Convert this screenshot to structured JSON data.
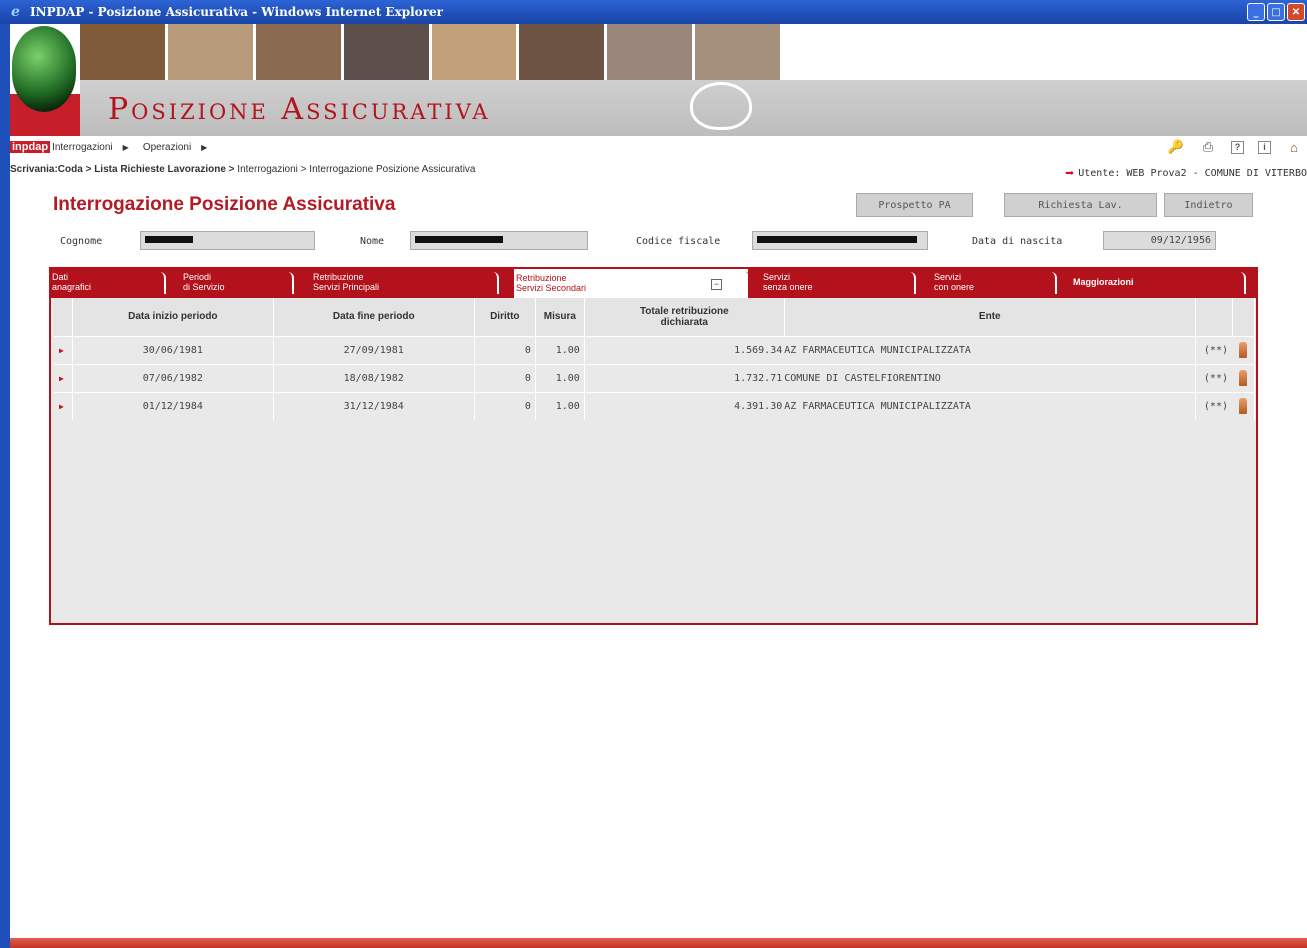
{
  "window": {
    "title": "INPDAP - Posizione Assicurativa - Windows Internet Explorer"
  },
  "header": {
    "title": "Posizione Assicurativa",
    "logo_text": "inpdap",
    "photo_colors": [
      "#7f5b3a",
      "#b69a7a",
      "#8a6b52",
      "#5d4f49",
      "#c2a07c",
      "#6d5344",
      "#99857a",
      "#a58f7d"
    ]
  },
  "menu": {
    "items": [
      {
        "label": "Interrogazioni"
      },
      {
        "label": "Operazioni"
      }
    ]
  },
  "breadcrumb": {
    "bold": "Scrivania:Coda > Lista Richieste Lavorazione >",
    "rest": " Interrogazioni > Interrogazione Posizione Assicurativa"
  },
  "user": {
    "label": "Utente: WEB Prova2 - COMUNE DI VITERBO"
  },
  "page": {
    "title": "Interrogazione Posizione Assicurativa",
    "buttons": {
      "prospetto": "Prospetto PA",
      "richiesta": "Richiesta Lav.",
      "indietro": "Indietro"
    }
  },
  "fields": {
    "cognome_label": "Cognome",
    "nome_label": "Nome",
    "codice_fiscale_label": "Codice fiscale",
    "data_nascita_label": "Data di nascita",
    "data_nascita_value": "09/12/1956"
  },
  "tabs": [
    {
      "line1": "Dati",
      "line2": "anagrafici"
    },
    {
      "line1": "Periodi",
      "line2": "di Servizio"
    },
    {
      "line1": "Retribuzione",
      "line2": "Servizi Principali"
    },
    {
      "line1": "Retribuzione",
      "line2": "Servizi Secondari"
    },
    {
      "line1": "Servizi",
      "line2": "senza onere"
    },
    {
      "line1": "Servizi",
      "line2": "con onere"
    },
    {
      "line1": "Maggiorazioni",
      "line2": ""
    }
  ],
  "table": {
    "headers": {
      "data_inizio": "Data inizio periodo",
      "data_fine": "Data fine periodo",
      "diritto": "Diritto",
      "misura": "Misura",
      "totale_1": "Totale retribuzione",
      "totale_2": "dichiarata",
      "ente": "Ente"
    },
    "rows": [
      {
        "inizio": "30/06/1981",
        "fine": "27/09/1981",
        "diritto": "0",
        "misura": "1.00",
        "totale": "1.569.34",
        "ente": "AZ FARMACEUTICA MUNICIPALIZZATA",
        "flag": "(**)"
      },
      {
        "inizio": "07/06/1982",
        "fine": "18/08/1982",
        "diritto": "0",
        "misura": "1.00",
        "totale": "1.732.71",
        "ente": "COMUNE DI CASTELFIORENTINO",
        "flag": "(**)"
      },
      {
        "inizio": "01/12/1984",
        "fine": "31/12/1984",
        "diritto": "0",
        "misura": "1.00",
        "totale": "4.391.30",
        "ente": "AZ FARMACEUTICA MUNICIPALIZZATA",
        "flag": "(**)"
      }
    ]
  }
}
